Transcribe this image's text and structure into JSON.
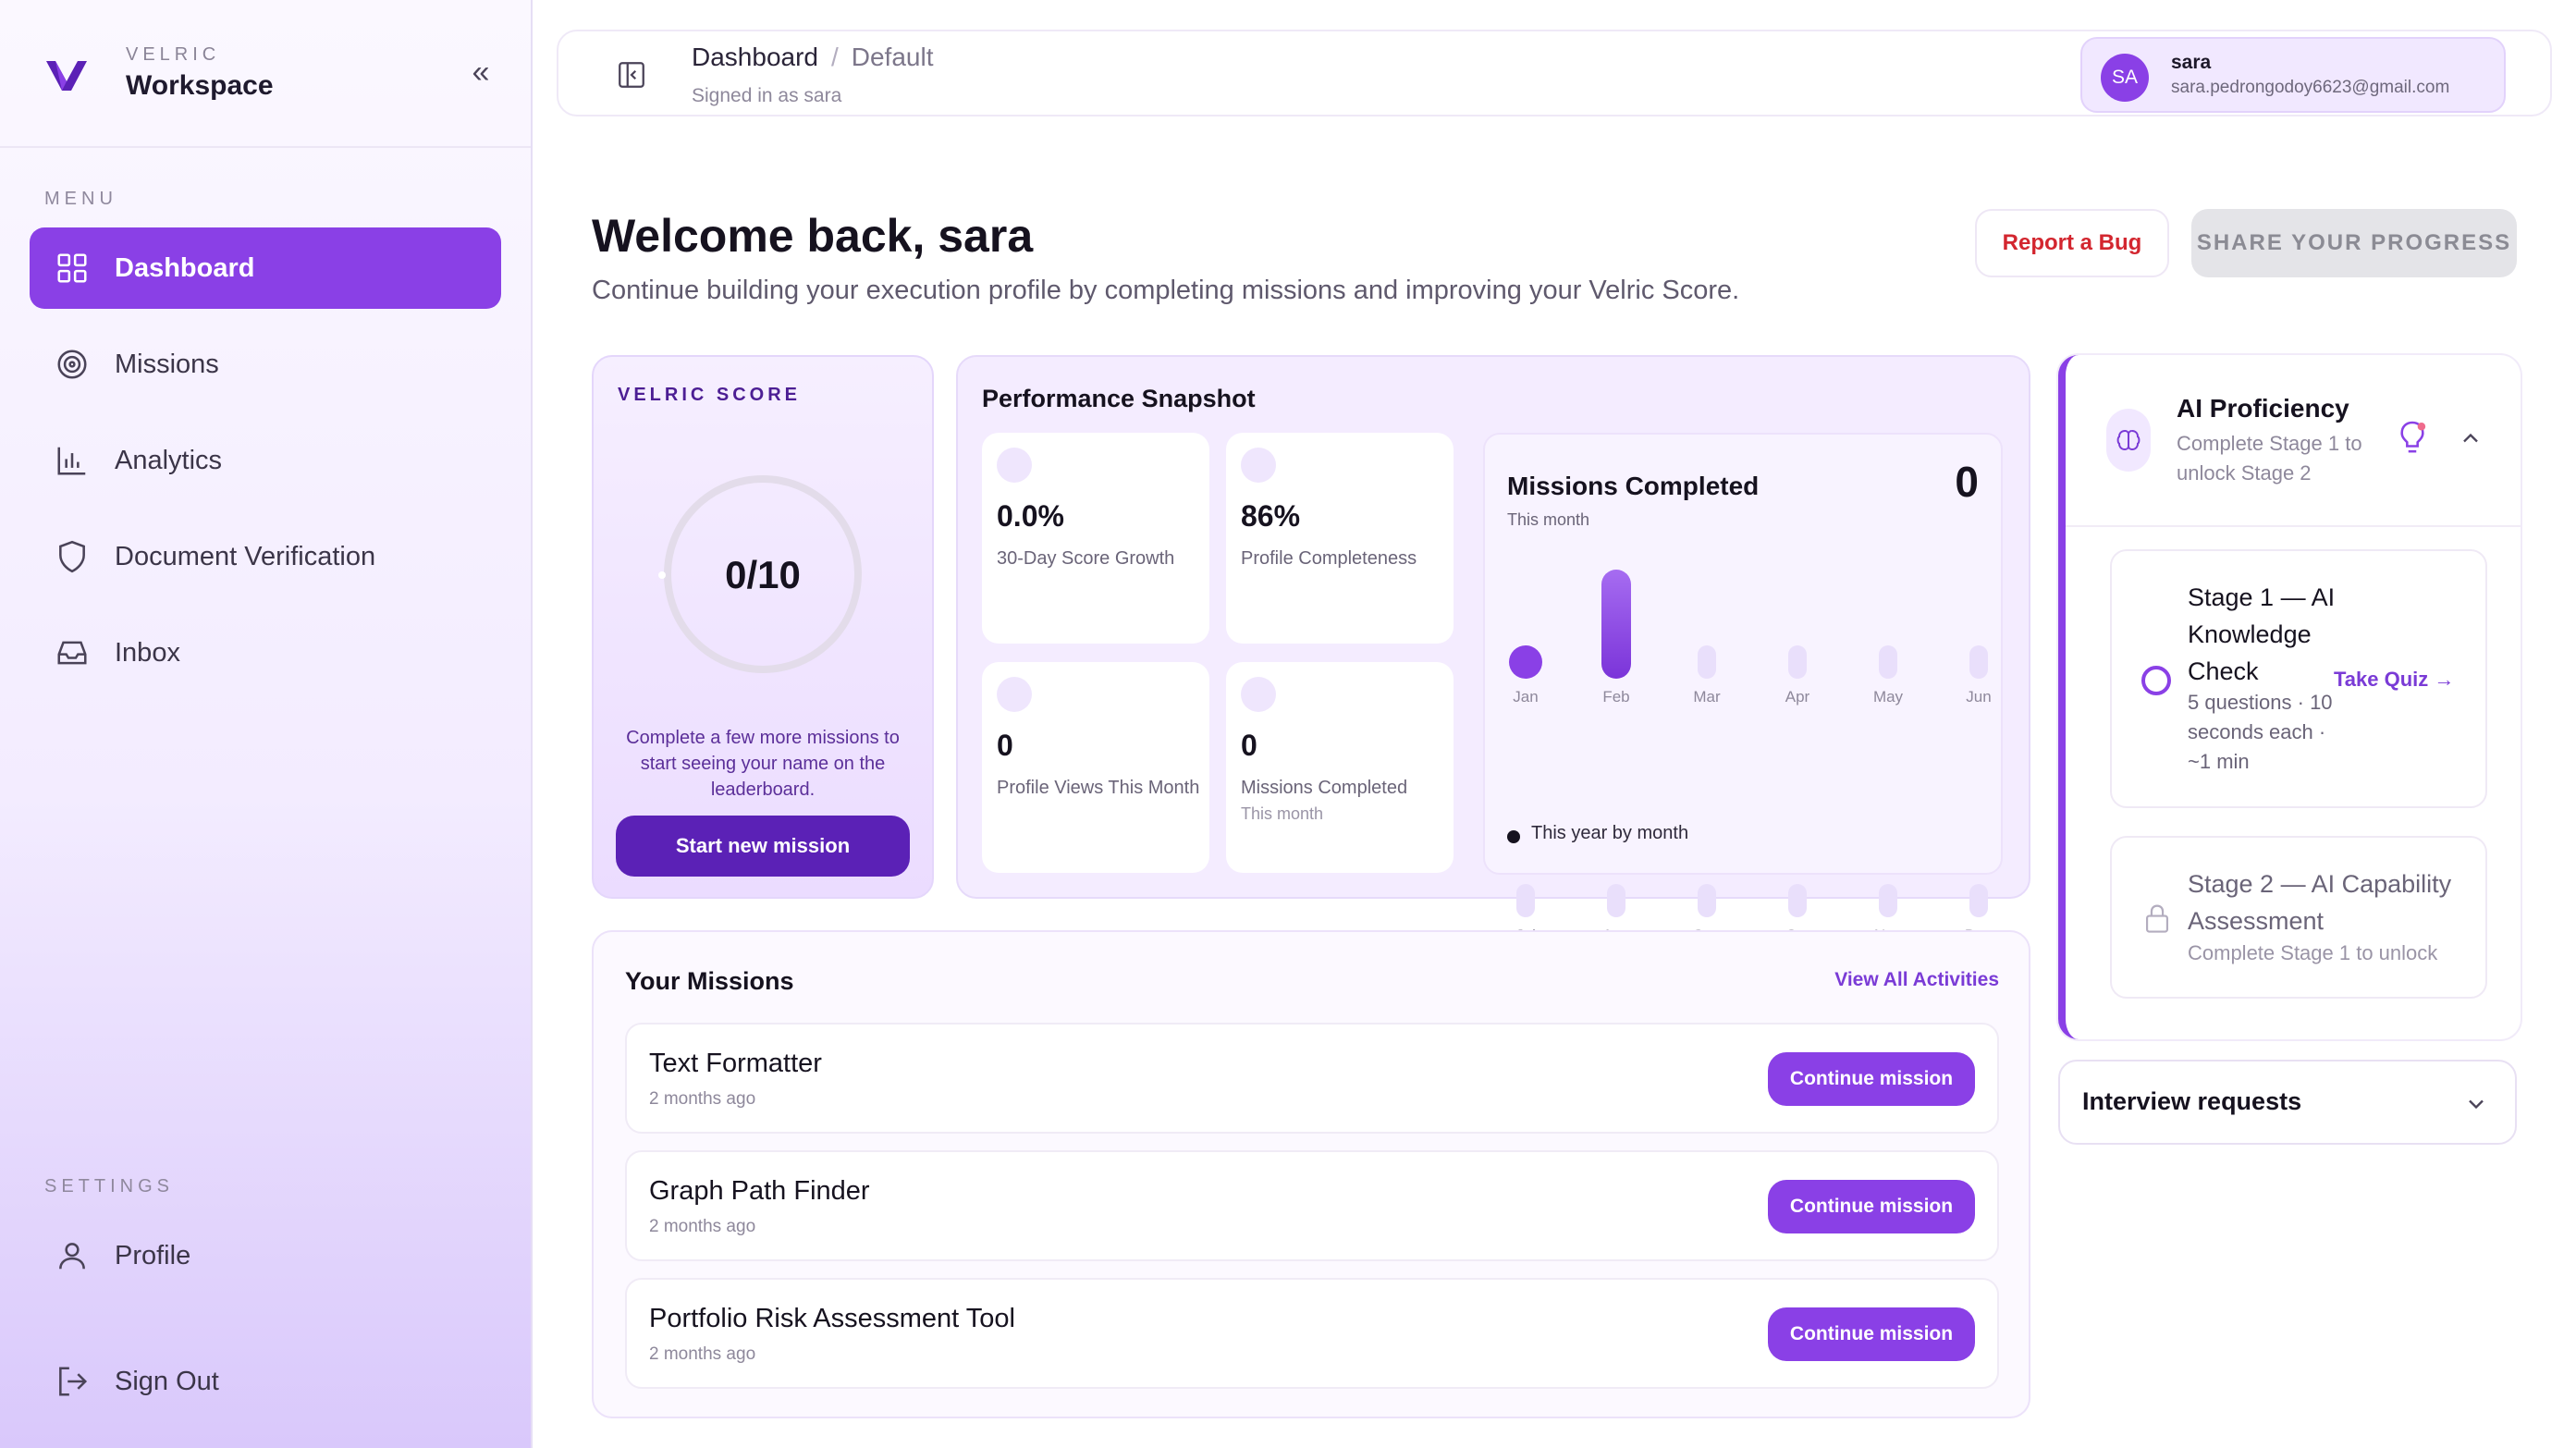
{
  "brand": {
    "small": "VELRIC",
    "big": "Workspace",
    "collapse_glyph": "«"
  },
  "sidebar": {
    "menu_heading": "MENU",
    "settings_heading": "SETTINGS",
    "items": [
      {
        "label": "Dashboard",
        "icon": "grid-icon",
        "active": true
      },
      {
        "label": "Missions",
        "icon": "target-icon"
      },
      {
        "label": "Analytics",
        "icon": "bar-chart-icon"
      },
      {
        "label": "Document Verification",
        "icon": "shield-icon"
      },
      {
        "label": "Inbox",
        "icon": "inbox-icon"
      }
    ],
    "settings_items": [
      {
        "label": "Profile",
        "icon": "user-icon"
      },
      {
        "label": "Sign Out",
        "icon": "sign-out-icon"
      }
    ]
  },
  "topbar": {
    "crumb_root": "Dashboard",
    "crumb_sep": "/",
    "crumb_current": "Default",
    "signed_in": "Signed in as sara",
    "user": {
      "initials": "SA",
      "name": "sara",
      "email": "sara.pedrongodoy6623@gmail.com"
    }
  },
  "header": {
    "welcome": "Welcome back, sara",
    "subtitle": "Continue building your execution profile by completing missions and improving your Velric Score.",
    "report_bug": "Report a Bug",
    "share": "SHARE YOUR PROGRESS"
  },
  "score": {
    "label": "VELRIC SCORE",
    "value": "0/10",
    "note": "Complete a few more missions to start seeing your name on the leaderboard.",
    "cta": "Start new mission"
  },
  "performance": {
    "title": "Performance Snapshot",
    "stats": [
      {
        "value": "0.0%",
        "label": "30-Day Score Growth",
        "sub": ""
      },
      {
        "value": "86%",
        "label": "Profile Completeness",
        "sub": ""
      },
      {
        "value": "0",
        "label": "Profile Views This Month",
        "sub": ""
      },
      {
        "value": "0",
        "label": "Missions Completed",
        "sub": "This month"
      }
    ]
  },
  "chart_data": {
    "type": "bar",
    "title": "Missions Completed",
    "subtitle": "This month",
    "headline_value": "0",
    "categories": [
      "Jan",
      "Feb",
      "Mar",
      "Apr",
      "May",
      "Jun",
      "Jul",
      "Aug",
      "Sep",
      "Oct",
      "Nov",
      "Dec"
    ],
    "series": [
      {
        "name": "This year by month",
        "values": [
          0,
          1,
          0,
          0,
          0,
          0,
          0,
          0,
          0,
          0,
          0,
          0
        ]
      }
    ],
    "legend": "This year by month",
    "legend_position": "bottom-left",
    "grid": false
  },
  "missions": {
    "title": "Your Missions",
    "view_all": "View All Activities",
    "items": [
      {
        "name": "Text Formatter",
        "time": "2 months ago",
        "cta": "Continue mission"
      },
      {
        "name": "Graph Path Finder",
        "time": "2 months ago",
        "cta": "Continue mission"
      },
      {
        "name": "Portfolio Risk Assessment Tool",
        "time": "2 months ago",
        "cta": "Continue mission"
      }
    ]
  },
  "ai": {
    "title": "AI Proficiency",
    "subtitle": "Complete Stage 1 to unlock Stage 2",
    "stage1": {
      "title": "Stage 1 — AI Knowledge Check",
      "meta": "5 questions · 10 seconds each · ~1 min",
      "cta": "Take Quiz →"
    },
    "stage2": {
      "title": "Stage 2 — AI Capability Assessment",
      "meta": "Complete Stage 1 to unlock"
    }
  },
  "interview": {
    "title": "Interview requests"
  },
  "colors": {
    "accent": "#8a40e6",
    "accent_dark": "#5b21b6",
    "danger": "#d3262f"
  }
}
